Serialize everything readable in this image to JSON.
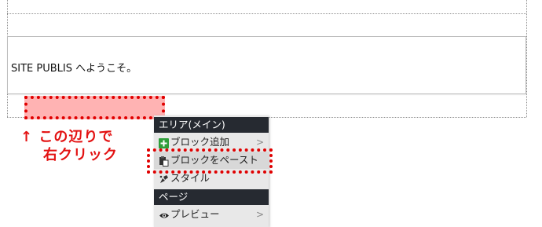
{
  "content": {
    "welcome_text": "SITE PUBLIS へようこそ。"
  },
  "annotation": {
    "line1": "↑ この辺りで",
    "line2": "右クリック"
  },
  "context_menu": {
    "area_header": "エリア(メイン)",
    "items_area": [
      {
        "label": "ブロック追加",
        "icon": "plus-icon",
        "has_submenu": true
      },
      {
        "label": "ブロックをペースト",
        "icon": "paste-icon",
        "has_submenu": false
      },
      {
        "label": "スタイル",
        "icon": "style-icon",
        "has_submenu": false
      }
    ],
    "page_header": "ページ",
    "items_page": [
      {
        "label": "プレビュー",
        "icon": "eye-icon",
        "has_submenu": true
      }
    ],
    "submenu_arrow": ">"
  },
  "colors": {
    "highlight_fill": "#ffb3b3",
    "highlight_border": "#e00000",
    "annotation_text": "#e31212",
    "menu_header_bg": "#262a31",
    "menu_bg": "#e8e8e8",
    "plus_icon_bg": "#2e9e3a"
  }
}
